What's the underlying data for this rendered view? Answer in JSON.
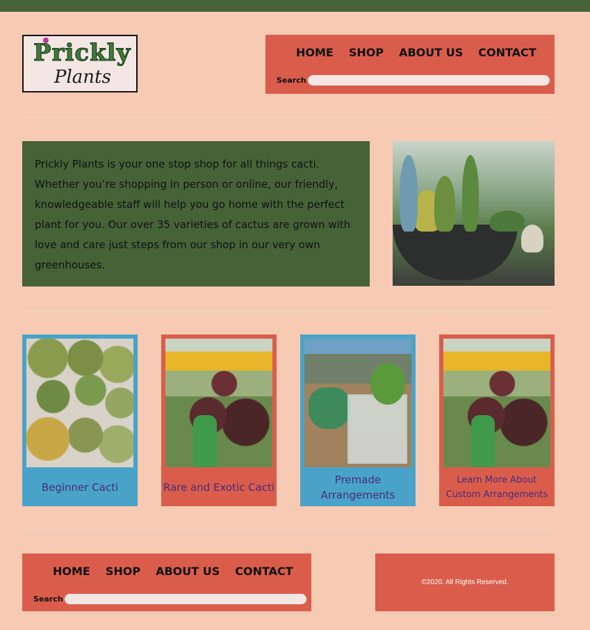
{
  "brand": {
    "line1": "Prickly",
    "line2": "Plants"
  },
  "nav": {
    "items": [
      "HOME",
      "SHOP",
      "ABOUT US",
      "CONTACT"
    ],
    "search_label": "Search",
    "search_value": ""
  },
  "intro": {
    "text": "Prickly Plants is your one stop shop for all things cacti. Whether you’re shopping in person or online, our friendly, knowledgeable staff will help you go home with the perfect plant for you. Our over 35 varieties of cactus are grown with love and care just steps from our shop in our very own greenhouses."
  },
  "cards": [
    {
      "label": "Beginner Cacti"
    },
    {
      "label": "Rare and Exotic Cacti"
    },
    {
      "label": "Premade Arrangements"
    },
    {
      "label": "Learn More About Custom Arrangements"
    }
  ],
  "footer": {
    "copyright": "©2020. All Rights Reserved."
  },
  "colors": {
    "background": "#f6cab3",
    "green": "#466337",
    "coral": "#da5d4c",
    "blue": "#49a3c9",
    "link_purple": "#4a2b7a"
  }
}
